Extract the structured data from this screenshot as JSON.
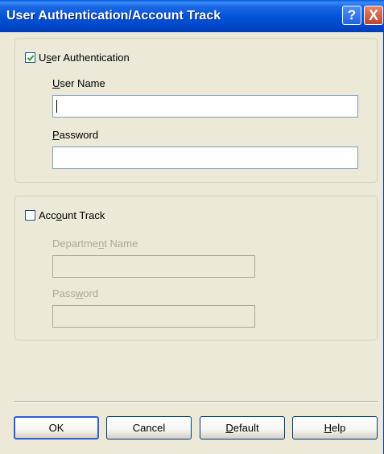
{
  "window": {
    "title": "User Authentication/Account Track",
    "help_label": "?",
    "close_label": "X"
  },
  "user_auth": {
    "checkbox_label_pre": "U",
    "checkbox_label_ul": "s",
    "checkbox_label_post": "er Authentication",
    "checked": true,
    "username_label_ul": "U",
    "username_label_post": "ser Name",
    "username_value": "",
    "password_label_ul": "P",
    "password_label_post": "assword",
    "password_value": ""
  },
  "account_track": {
    "checkbox_label_pre": "Acc",
    "checkbox_label_ul": "o",
    "checkbox_label_post": "unt Track",
    "checked": false,
    "dept_label_pre": "Departme",
    "dept_label_ul": "n",
    "dept_label_post": "t Name",
    "dept_value": "",
    "password_label_pre": "Pass",
    "password_label_ul": "w",
    "password_label_post": "ord",
    "password_value": ""
  },
  "buttons": {
    "ok": "OK",
    "cancel": "Cancel",
    "default_ul": "D",
    "default_post": "efault",
    "help_ul": "H",
    "help_post": "elp"
  }
}
